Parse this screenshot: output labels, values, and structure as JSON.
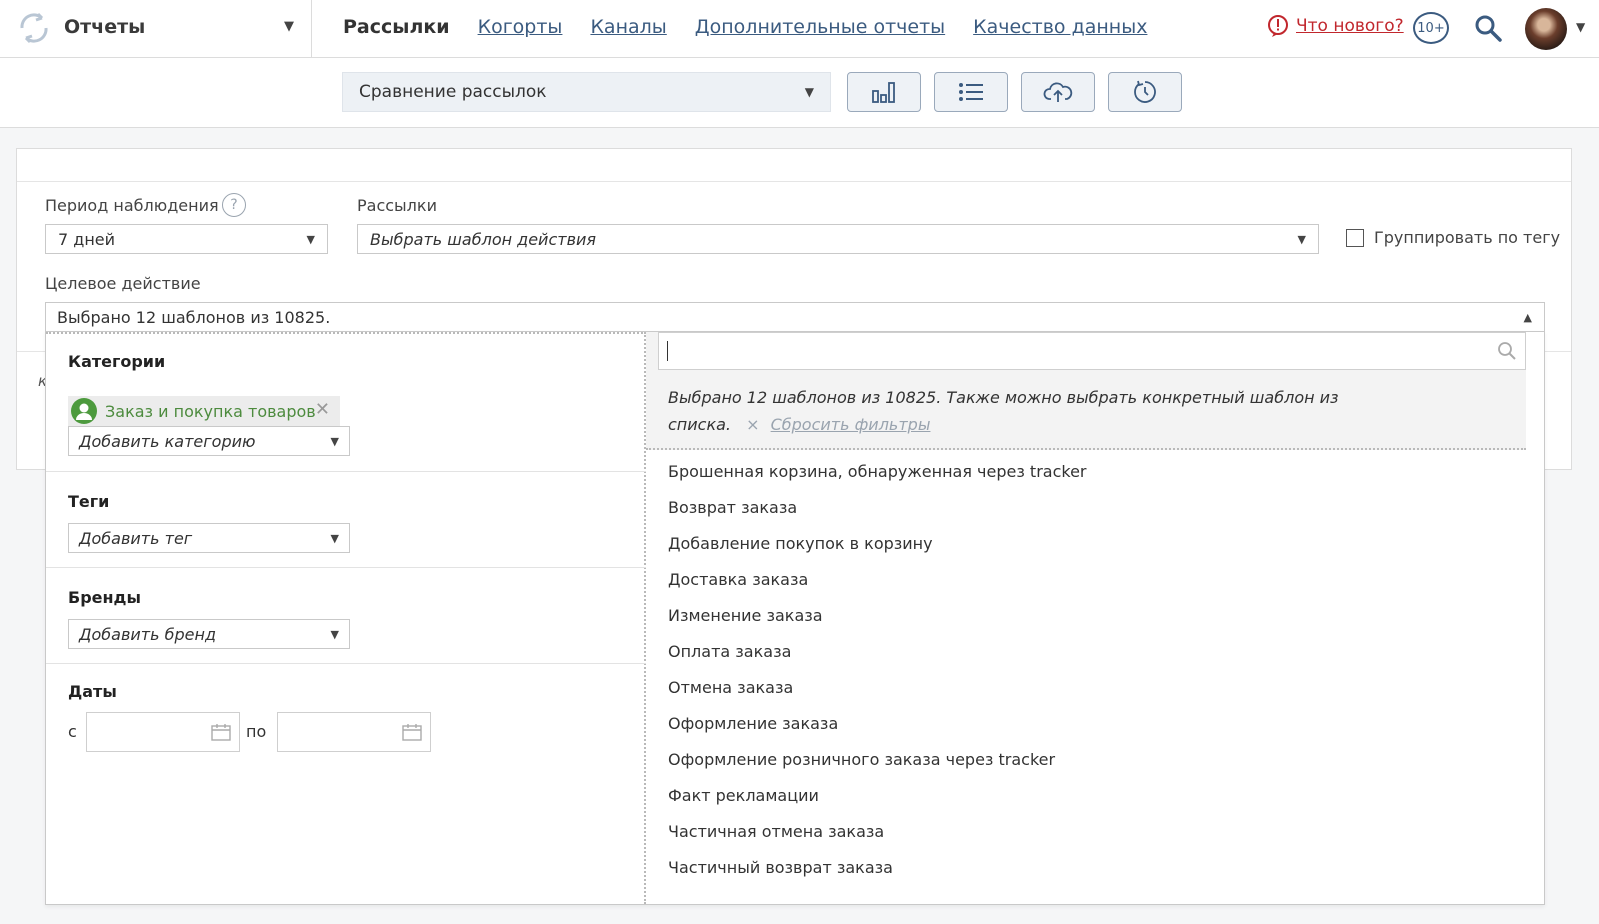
{
  "header": {
    "app_title": "Отчеты",
    "nav": [
      {
        "label": "Рассылки",
        "active": true
      },
      {
        "label": "Когорты",
        "active": false
      },
      {
        "label": "Каналы",
        "active": false
      },
      {
        "label": "Дополнительные отчеты",
        "active": false
      },
      {
        "label": "Качество данных",
        "active": false
      }
    ],
    "whats_new": "Что нового?",
    "notifications_count": "10+"
  },
  "toolbar": {
    "report_select": "Сравнение рассылок",
    "buttons": [
      "chart-icon",
      "list-icon",
      "cloud-upload-icon",
      "history-icon"
    ]
  },
  "filters": {
    "period_label": "Период наблюдения",
    "help_symbol": "?",
    "period_value": "7 дней",
    "mailings_label": "Рассылки",
    "mailings_placeholder": "Выбрать шаблон действия",
    "group_by_tag_label": "Группировать по тегу",
    "group_by_tag_checked": false,
    "target_label": "Целевое действие",
    "target_value": "Выбрано 12 шаблонов из 10825."
  },
  "dropdown": {
    "categories_title": "Категории",
    "category_chip": "Заказ и покупка товаров",
    "add_category": "Добавить категорию",
    "tags_title": "Теги",
    "add_tag": "Добавить тег",
    "brands_title": "Бренды",
    "add_brand": "Добавить бренд",
    "dates_title": "Даты",
    "date_from_label": "с",
    "date_to_label": "по",
    "hint_text": "Выбрано 12 шаблонов из 10825. Также можно выбрать конкретный шаблон из списка.",
    "reset_symbol": "×",
    "reset_label": "Сбросить фильтры",
    "options": [
      "Брошенная корзина, обнаруженная через tracker",
      "Возврат заказа",
      "Добавление покупок в корзину",
      "Доставка заказа",
      "Изменение заказа",
      "Оплата заказа",
      "Отмена заказа",
      "Оформление заказа",
      "Оформление розничного заказа через tracker",
      "Факт рекламации",
      "Частичная отмена заказа",
      "Частичный возврат заказа"
    ]
  },
  "colors": {
    "link": "#3b5b80",
    "alert": "#c1272d",
    "chip_text": "#4d8b3e",
    "muted": "#9aa4af"
  }
}
